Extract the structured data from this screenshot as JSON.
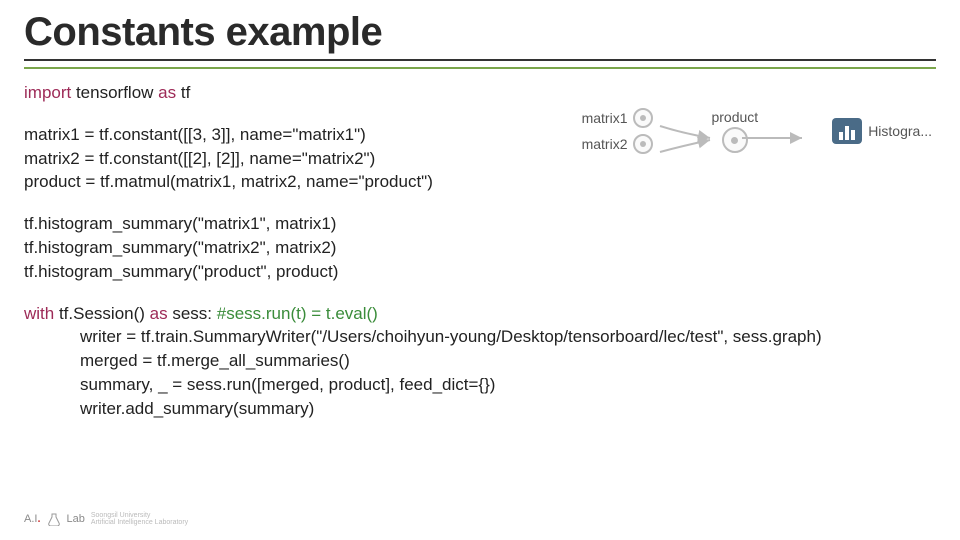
{
  "title": "Constants example",
  "code": {
    "l1a": "import",
    "l1b": " tensorflow ",
    "l1c": "as",
    "l1d": " tf",
    "l2": "matrix1 = tf.constant([[3, 3]], name=\"matrix1\")",
    "l3": "matrix2 = tf.constant([[2], [2]], name=\"matrix2\")",
    "l4": "product = tf.matmul(matrix1, matrix2, name=\"product\")",
    "l5": "tf.histogram_summary(\"matrix1\", matrix1)",
    "l6": "tf.histogram_summary(\"matrix2\", matrix2)",
    "l7": "tf.histogram_summary(\"product\", product)",
    "l8a": "with",
    "l8b": " tf.Session() ",
    "l8c": "as",
    "l8d": " sess: ",
    "l8e": "#sess.run(t) = t.eval()",
    "l9": "writer = tf.train.SummaryWriter(\"/Users/choihyun-young/Desktop/tensorboard/lec/test\", sess.graph)",
    "l10": "merged = tf.merge_all_summaries()",
    "l11": "summary, _ = sess.run([merged, product], feed_dict={})",
    "l12": "writer.add_summary(summary)"
  },
  "diagram": {
    "node1": "matrix1",
    "node2": "matrix2",
    "product": "product",
    "hist": "Histogra..."
  },
  "footer": {
    "brand": "A.I",
    "lab": "Lab",
    "sub1": "Soongsil University",
    "sub2": "Artificial Intelligence Laboratory"
  }
}
